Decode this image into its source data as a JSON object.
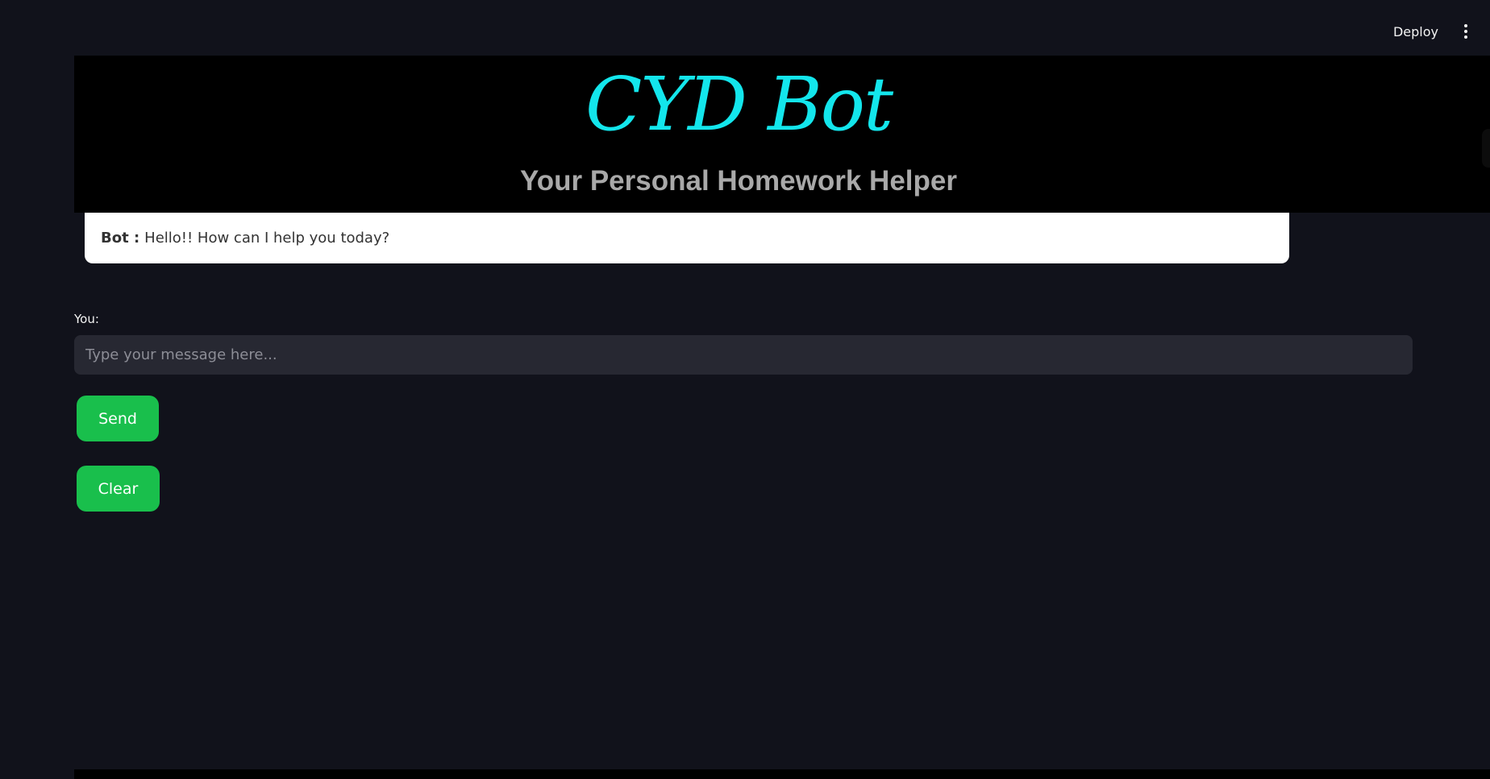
{
  "toolbar": {
    "deploy_label": "Deploy",
    "menu_icon": "more-vertical-icon"
  },
  "header": {
    "brand_title": "CYD Bot",
    "subtitle": "Your Personal Homework Helper",
    "brand_color": "#13e6ec"
  },
  "chat": {
    "bot_label": "Bot :",
    "bot_message": "Hello!! How can I help you today?"
  },
  "input": {
    "label": "You:",
    "placeholder": "Type your message here...",
    "value": ""
  },
  "buttons": {
    "send_label": "Send",
    "clear_label": "Clear",
    "color": "#19bf4c"
  }
}
